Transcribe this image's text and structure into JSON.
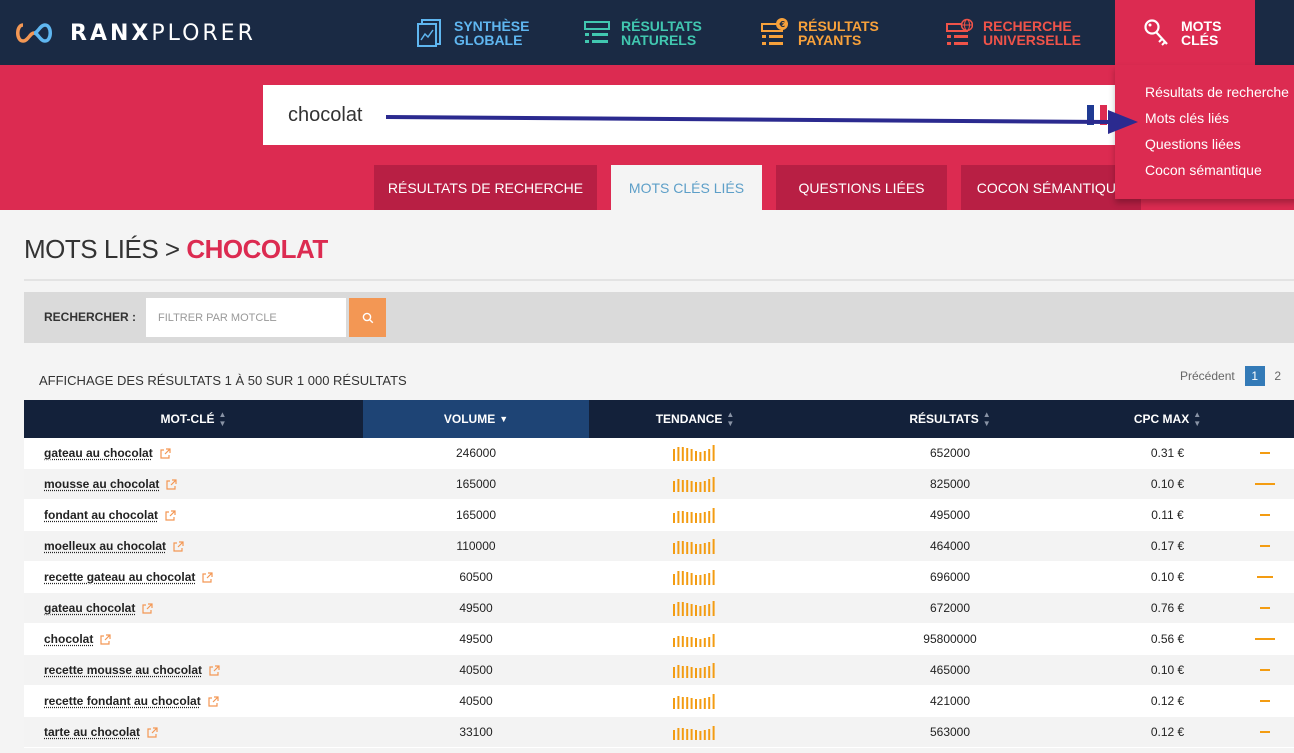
{
  "brand": {
    "logo_text_strong": "RANX",
    "logo_text_light": "PLORER"
  },
  "nav": {
    "synthese": {
      "line1": "SYNTHÈSE",
      "line2": "GLOBALE"
    },
    "naturels": {
      "line1": "RÉSULTATS",
      "line2": "NATURELS"
    },
    "payants": {
      "line1": "RÉSULTATS",
      "line2": "PAYANTS"
    },
    "universelle": {
      "line1": "RECHERCHE",
      "line2": "UNIVERSELLE"
    },
    "mots": {
      "line1": "MOTS",
      "line2": "CLÉS"
    }
  },
  "dropdown": {
    "items": [
      "Résultats de recherche",
      "Mots clés liés",
      "Questions liées",
      "Cocon sémantique"
    ]
  },
  "search": {
    "value": "chocolat"
  },
  "tabs": [
    "RÉSULTATS DE RECHERCHE",
    "MOTS CLÉS LIÉS",
    "QUESTIONS LIÉES",
    "COCON SÉMANTIQUE"
  ],
  "page": {
    "title_prefix": "MOTS LIÉS > ",
    "title_keyword": "CHOCOLAT"
  },
  "filter": {
    "label": "RECHERCHER :",
    "placeholder": "FILTRER PAR MOTCLE"
  },
  "results": {
    "info": "AFFICHAGE DES RÉSULTATS 1 À 50 SUR 1 000 RÉSULTATS"
  },
  "pager": {
    "prev": "Précédent",
    "pages": [
      "1",
      "2"
    ],
    "active": "1"
  },
  "table": {
    "headers": {
      "keyword": "MOT-CLÉ",
      "volume": "VOLUME",
      "trend": "TENDANCE",
      "results": "RÉSULTATS",
      "cpc": "CPC MAX"
    },
    "rows": [
      {
        "keyword": "gateau au chocolat",
        "volume": "246000",
        "results": "652000",
        "cpc": "0.31 €"
      },
      {
        "keyword": "mousse au chocolat",
        "volume": "165000",
        "results": "825000",
        "cpc": "0.10 €"
      },
      {
        "keyword": "fondant au chocolat",
        "volume": "165000",
        "results": "495000",
        "cpc": "0.11 €"
      },
      {
        "keyword": "moelleux au chocolat",
        "volume": "110000",
        "results": "464000",
        "cpc": "0.17 €"
      },
      {
        "keyword": "recette gateau au chocolat",
        "volume": "60500",
        "results": "696000",
        "cpc": "0.10 €"
      },
      {
        "keyword": "gateau chocolat",
        "volume": "49500",
        "results": "672000",
        "cpc": "0.76 €"
      },
      {
        "keyword": "chocolat",
        "volume": "49500",
        "results": "95800000",
        "cpc": "0.56 €"
      },
      {
        "keyword": "recette mousse au chocolat",
        "volume": "40500",
        "results": "465000",
        "cpc": "0.10 €"
      },
      {
        "keyword": "recette fondant au chocolat",
        "volume": "40500",
        "results": "421000",
        "cpc": "0.12 €"
      },
      {
        "keyword": "tarte au chocolat",
        "volume": "33100",
        "results": "563000",
        "cpc": "0.12 €"
      }
    ]
  },
  "colors": {
    "brand_red": "#dc2b51",
    "nav_bg": "#1a2a44",
    "accent_orange": "#f39754",
    "sorted_header": "#1e4475"
  },
  "icons": {
    "logo": "infinity-logo-icon",
    "synthese": "document-chart-icon",
    "naturels": "list-icon",
    "payants": "euro-list-icon",
    "universelle": "globe-list-icon",
    "mots": "key-icon",
    "filter_button": "search-icon",
    "external_link": "external-link-icon"
  }
}
